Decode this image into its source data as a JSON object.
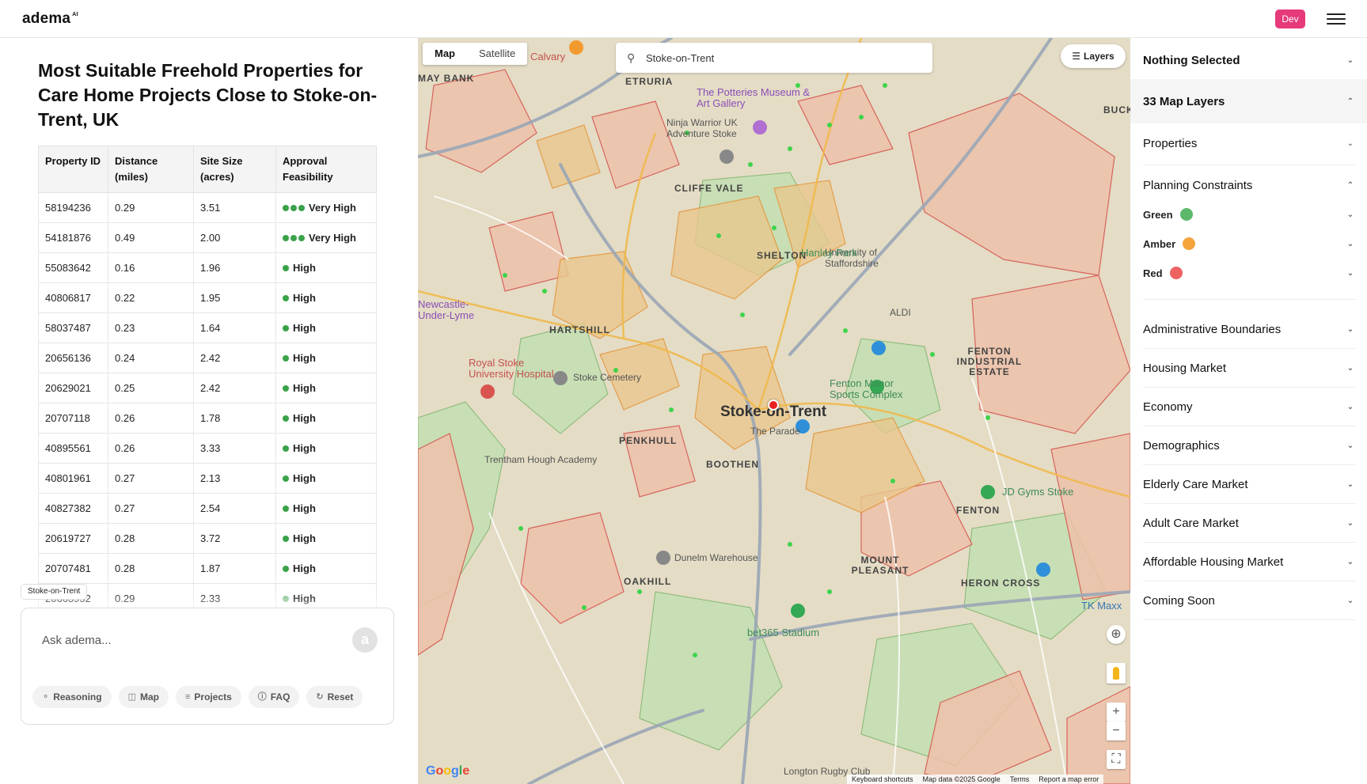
{
  "app": {
    "logo": "adema",
    "logo_sup": "AI",
    "env_badge": "Dev"
  },
  "left": {
    "title": "Most Suitable Freehold Properties for Care Home Projects Close to Stoke-on-Trent, UK",
    "table": {
      "headers": [
        "Property ID",
        "Distance (miles)",
        "Site Size (acres)",
        "Approval Feasibility"
      ],
      "rows": [
        {
          "id": "58194236",
          "distance": "0.29",
          "size": "3.51",
          "dots": 3,
          "feasibility": "Very High"
        },
        {
          "id": "54181876",
          "distance": "0.49",
          "size": "2.00",
          "dots": 3,
          "feasibility": "Very High"
        },
        {
          "id": "55083642",
          "distance": "0.16",
          "size": "1.96",
          "dots": 1,
          "feasibility": "High"
        },
        {
          "id": "40806817",
          "distance": "0.22",
          "size": "1.95",
          "dots": 1,
          "feasibility": "High"
        },
        {
          "id": "58037487",
          "distance": "0.23",
          "size": "1.64",
          "dots": 1,
          "feasibility": "High"
        },
        {
          "id": "20656136",
          "distance": "0.24",
          "size": "2.42",
          "dots": 1,
          "feasibility": "High"
        },
        {
          "id": "20629021",
          "distance": "0.25",
          "size": "2.42",
          "dots": 1,
          "feasibility": "High"
        },
        {
          "id": "20707118",
          "distance": "0.26",
          "size": "1.78",
          "dots": 1,
          "feasibility": "High"
        },
        {
          "id": "40895561",
          "distance": "0.26",
          "size": "3.33",
          "dots": 1,
          "feasibility": "High"
        },
        {
          "id": "40801961",
          "distance": "0.27",
          "size": "2.13",
          "dots": 1,
          "feasibility": "High"
        },
        {
          "id": "40827382",
          "distance": "0.27",
          "size": "2.54",
          "dots": 1,
          "feasibility": "High"
        },
        {
          "id": "20619727",
          "distance": "0.28",
          "size": "3.72",
          "dots": 1,
          "feasibility": "High"
        },
        {
          "id": "20707481",
          "distance": "0.28",
          "size": "1.87",
          "dots": 1,
          "feasibility": "High"
        },
        {
          "id": "20663952",
          "distance": "0.29",
          "size": "2.33",
          "dots": 1,
          "feasibility": "High"
        }
      ]
    },
    "context_chip": "Stoke-on-Trent",
    "chat": {
      "placeholder": "Ask adema...",
      "send_icon": "a",
      "actions": [
        {
          "label": "Reasoning",
          "icon": "brain-icon"
        },
        {
          "label": "Map",
          "icon": "map-icon"
        },
        {
          "label": "Projects",
          "icon": "list-icon"
        },
        {
          "label": "FAQ",
          "icon": "help-circle-icon"
        },
        {
          "label": "Reset",
          "icon": "refresh-icon"
        }
      ]
    }
  },
  "map": {
    "tabs": [
      "Map",
      "Satellite"
    ],
    "active_tab": "Map",
    "search_value": "Stoke-on-Trent",
    "layers_label": "Layers",
    "labels": {
      "city": "Stoke-on-Trent",
      "etruria": "ETRURIA",
      "cliffe_vale": "CLIFFE VALE",
      "shelton": "SHELTON",
      "hartshill": "HARTSHILL",
      "penkhull": "PENKHULL",
      "boothen": "BOOTHEN",
      "oakhill": "OAKHILL",
      "fenton": "FENTON",
      "fenton_estate": "FENTON INDUSTRIAL ESTATE",
      "mount_pleasant": "MOUNT PLEASANT",
      "heron_cross": "HERON CROSS",
      "may_bank": "MAY BANK",
      "buck": "BUCK",
      "potteries": "The Potteries Museum & Art Gallery",
      "ninja": "Ninja Warrior UK Adventure Stoke",
      "hanley_park": "Hanley Park",
      "univ": "University of Staffordshire",
      "aldi": "ALDI",
      "royal_stoke": "Royal Stoke University Hospital",
      "cemetery": "Stoke Cemetery",
      "fenton_manor": "Fenton Manor Sports Complex",
      "the_parade": "The Parade",
      "academy": "Trentham Hough Academy",
      "dunelm": "Dunelm Warehouse",
      "stadium": "bet365 Stadium",
      "jd_gyms": "JD Gyms Stoke",
      "tk_maxx": "TK Maxx",
      "newcastle": "Newcastle-Under-Lyme",
      "longton": "Longton Rugby Club",
      "calvary": "Calvary"
    },
    "attribution": [
      "Keyboard shortcuts",
      "Map data ©2025 Google",
      "Terms",
      "Report a map error"
    ],
    "google": "Google"
  },
  "right": {
    "nothing_selected": "Nothing Selected",
    "map_layers": "33 Map Layers",
    "properties": "Properties",
    "planning": "Planning Constraints",
    "constraints": [
      {
        "label": "Green",
        "color": "#5cb86a"
      },
      {
        "label": "Amber",
        "color": "#f4a33b"
      },
      {
        "label": "Red",
        "color": "#ee6262"
      }
    ],
    "sections": [
      "Administrative Boundaries",
      "Housing Market",
      "Economy",
      "Demographics",
      "Elderly Care Market",
      "Adult Care Market",
      "Affordable Housing Market",
      "Coming Soon"
    ]
  }
}
